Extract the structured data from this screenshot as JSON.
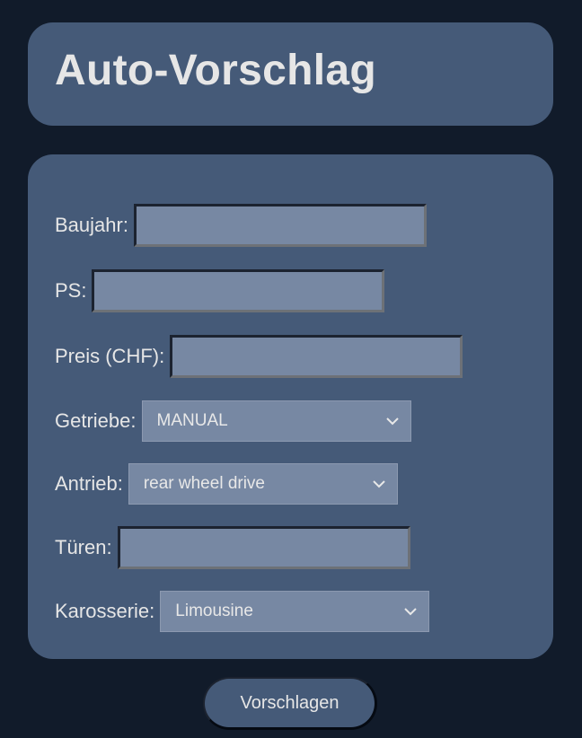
{
  "header": {
    "title": "Auto-Vorschlag"
  },
  "form": {
    "baujahr": {
      "label": "Baujahr:",
      "value": ""
    },
    "ps": {
      "label": "PS:",
      "value": ""
    },
    "preis": {
      "label": "Preis (CHF):",
      "value": ""
    },
    "getriebe": {
      "label": "Getriebe:",
      "selected": "MANUAL"
    },
    "antrieb": {
      "label": "Antrieb:",
      "selected": "rear wheel drive"
    },
    "tueren": {
      "label": "Türen:",
      "value": ""
    },
    "karosserie": {
      "label": "Karosserie:",
      "selected": "Limousine"
    }
  },
  "actions": {
    "submit_label": "Vorschlagen"
  },
  "colors": {
    "page_background": "#111b2a",
    "card_background": "#455a78",
    "field_background": "#7788a3"
  },
  "icons": {
    "dropdown": "chevron-down-icon"
  }
}
